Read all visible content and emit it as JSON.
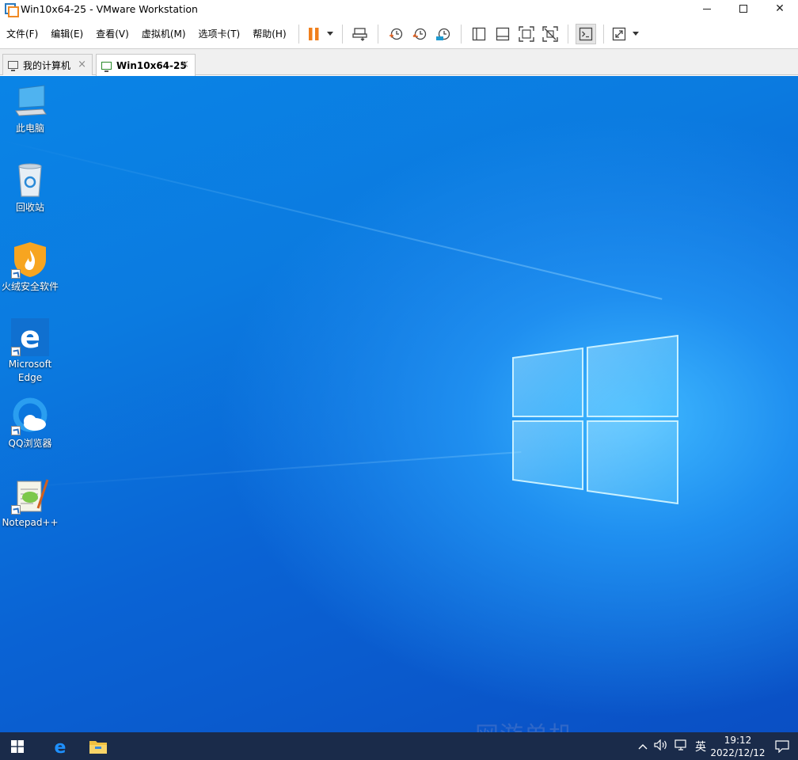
{
  "window": {
    "title": "Win10x64-25 - VMware Workstation",
    "min_icon": "minimize-icon",
    "max_icon": "maximize-icon",
    "close_label": "✕"
  },
  "menu": {
    "items": [
      "文件(F)",
      "编辑(E)",
      "查看(V)",
      "虚拟机(M)",
      "选项卡(T)",
      "帮助(H)"
    ]
  },
  "toolbar": {
    "icons": [
      "pause-icon",
      "send-ctrl-alt-del-icon",
      "snapshot-take-icon",
      "snapshot-revert-icon",
      "snapshot-manager-icon",
      "library-view-icon",
      "thumbnail-view-icon",
      "fullscreen-icon",
      "unity-icon",
      "console-view-icon",
      "stretch-guest-icon"
    ],
    "pause_color": "#f07f1c"
  },
  "tabs": [
    {
      "label": "我的计算机",
      "close": "×",
      "active": false
    },
    {
      "label": "Win10x64-25",
      "close": "×",
      "active": true
    }
  ],
  "desktop": {
    "icons": [
      {
        "label": "此电脑",
        "icon": "this-pc-icon"
      },
      {
        "label": "回收站",
        "icon": "recycle-bin-icon"
      },
      {
        "label": "火绒安全软件",
        "icon": "huorong-security-icon"
      },
      {
        "label": "Microsoft\nEdge",
        "label_line1": "Microsoft",
        "label_line2": "Edge",
        "icon": "edge-icon"
      },
      {
        "label": "QQ浏览器",
        "icon": "qq-browser-icon"
      },
      {
        "label": "Notepad++",
        "icon": "notepad-plus-plus-icon"
      }
    ],
    "watermark": "网游单机 JiaoBenWang.Com"
  },
  "taskbar": {
    "tray_lang": "英",
    "time": "19:12",
    "date": "2022/12/12",
    "accent": "#1a2b4a"
  }
}
